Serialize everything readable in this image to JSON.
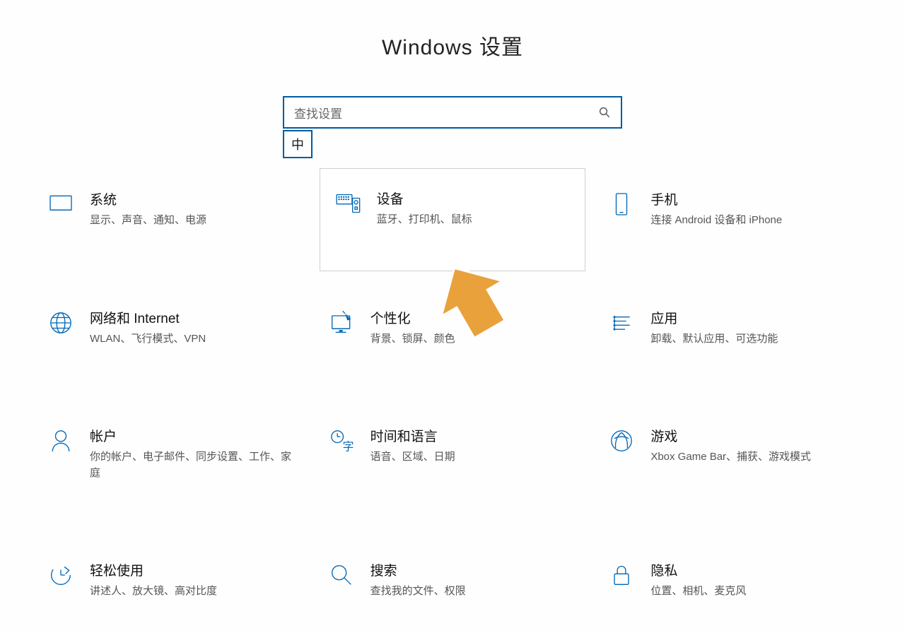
{
  "header": {
    "title": "Windows 设置"
  },
  "search": {
    "placeholder": "查找设置",
    "ime_badge": "中"
  },
  "categories": [
    {
      "key": "system",
      "title": "系统",
      "desc": "显示、声音、通知、电源"
    },
    {
      "key": "devices",
      "title": "设备",
      "desc": "蓝牙、打印机、鼠标"
    },
    {
      "key": "phone",
      "title": "手机",
      "desc": "连接 Android 设备和 iPhone"
    },
    {
      "key": "network",
      "title": "网络和 Internet",
      "desc": "WLAN、飞行模式、VPN"
    },
    {
      "key": "personalization",
      "title": "个性化",
      "desc": "背景、锁屏、颜色"
    },
    {
      "key": "apps",
      "title": "应用",
      "desc": "卸载、默认应用、可选功能"
    },
    {
      "key": "accounts",
      "title": "帐户",
      "desc": "你的帐户、电子邮件、同步设置、工作、家庭"
    },
    {
      "key": "time",
      "title": "时间和语言",
      "desc": "语音、区域、日期"
    },
    {
      "key": "gaming",
      "title": "游戏",
      "desc": "Xbox Game Bar、捕获、游戏模式"
    },
    {
      "key": "ease",
      "title": "轻松使用",
      "desc": "讲述人、放大镜、高对比度"
    },
    {
      "key": "searchcat",
      "title": "搜索",
      "desc": "查找我的文件、权限"
    },
    {
      "key": "privacy",
      "title": "隐私",
      "desc": "位置、相机、麦克风"
    }
  ],
  "highlighted_key": "devices",
  "colors": {
    "accent": "#0067b8",
    "border_highlight": "#005a9e",
    "arrow": "#e9a13b"
  }
}
